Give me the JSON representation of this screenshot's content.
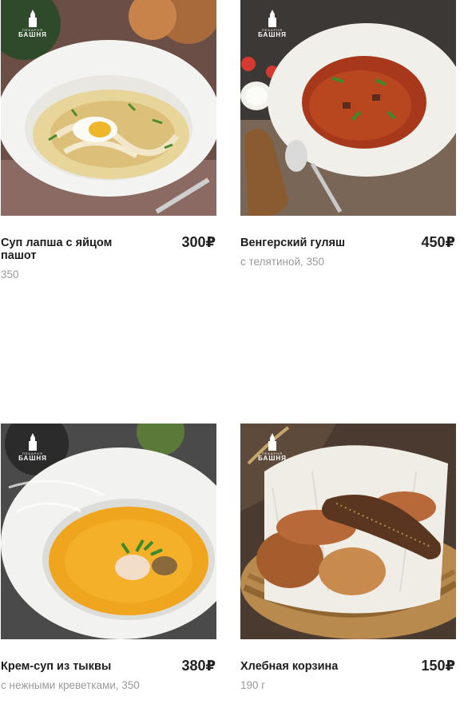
{
  "brand": {
    "subtitle": "ПЕКАРНЯ",
    "name": "БАШНЯ"
  },
  "colors": {
    "title": "#1d1d1d",
    "price": "#222222",
    "description": "#9a9a9a",
    "background": "#ffffff"
  },
  "products": [
    {
      "title": "Суп лапша с яйцом пашот",
      "price": "300₽",
      "description": "350"
    },
    {
      "title": "Венгерский гуляш",
      "price": "450₽",
      "description": "с телятиной, 350"
    },
    {
      "title": "Крем-суп из тыквы",
      "price": "380₽",
      "description": "с нежными креветками, 350"
    },
    {
      "title": "Хлебная корзина",
      "price": "150₽",
      "description": "190 г"
    }
  ]
}
